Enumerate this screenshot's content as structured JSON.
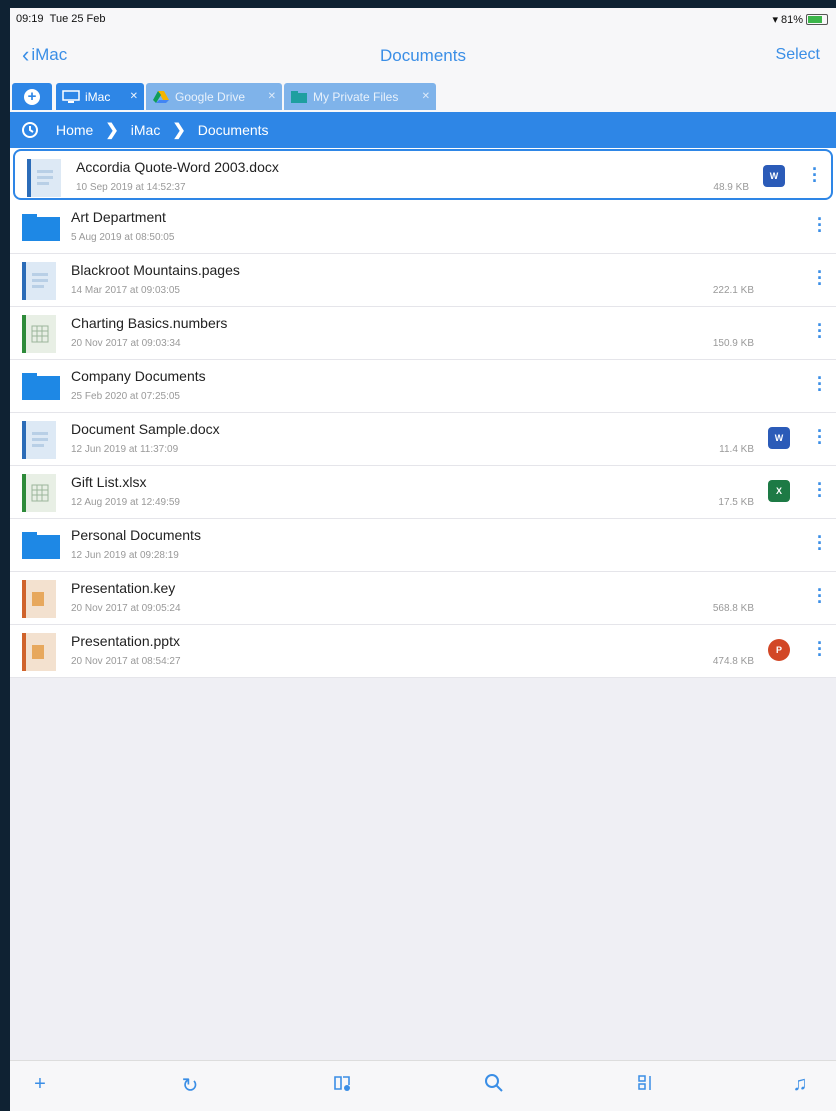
{
  "status": {
    "time": "09:19",
    "date": "Tue 25 Feb",
    "battery": "81%"
  },
  "nav": {
    "back_label": "iMac",
    "title": "Documents",
    "select_label": "Select"
  },
  "tabs": [
    {
      "label": "iMac",
      "icon": "monitor-icon"
    },
    {
      "label": "Google Drive",
      "icon": "google-drive-icon"
    },
    {
      "label": "My Private Files",
      "icon": "folder-icon"
    }
  ],
  "breadcrumb": {
    "items": [
      "Home",
      "iMac",
      "Documents"
    ]
  },
  "files": [
    {
      "name": "Accordia Quote-Word 2003.docx",
      "date": "10 Sep 2019 at 14:52:37",
      "size": "48.9 KB",
      "kind": "doc",
      "app": "word"
    },
    {
      "name": "Art Department",
      "date": "5 Aug 2019 at 08:50:05",
      "size": "",
      "kind": "folder",
      "app": ""
    },
    {
      "name": "Blackroot Mountains.pages",
      "date": "14 Mar 2017 at 09:03:05",
      "size": "222.1 KB",
      "kind": "doc",
      "app": ""
    },
    {
      "name": "Charting Basics.numbers",
      "date": "20 Nov 2017 at 09:03:34",
      "size": "150.9 KB",
      "kind": "sheet",
      "app": ""
    },
    {
      "name": "Company Documents",
      "date": "25 Feb 2020 at 07:25:05",
      "size": "",
      "kind": "folder",
      "app": ""
    },
    {
      "name": "Document Sample.docx",
      "date": "12 Jun 2019 at 11:37:09",
      "size": "11.4 KB",
      "kind": "doc",
      "app": "word"
    },
    {
      "name": "Gift List.xlsx",
      "date": "12 Aug 2019 at 12:49:59",
      "size": "17.5 KB",
      "kind": "sheet",
      "app": "excel"
    },
    {
      "name": "Personal Documents",
      "date": "12 Jun 2019 at 09:28:19",
      "size": "",
      "kind": "folder",
      "app": ""
    },
    {
      "name": "Presentation.key",
      "date": "20 Nov 2017 at 09:05:24",
      "size": "568.8 KB",
      "kind": "slides",
      "app": ""
    },
    {
      "name": "Presentation.pptx",
      "date": "20 Nov 2017 at 08:54:27",
      "size": "474.8 KB",
      "kind": "slides",
      "app": "ppt"
    }
  ],
  "toolbar": [
    "plus-icon",
    "refresh-icon",
    "bookmark-icon",
    "search-icon",
    "sort-icon",
    "music-icon"
  ],
  "colors": {
    "accent": "#2e86e6",
    "folder": "#1e88e5",
    "word": "#2b5bb8",
    "excel": "#1d7a45",
    "powerpoint": "#d24726"
  }
}
